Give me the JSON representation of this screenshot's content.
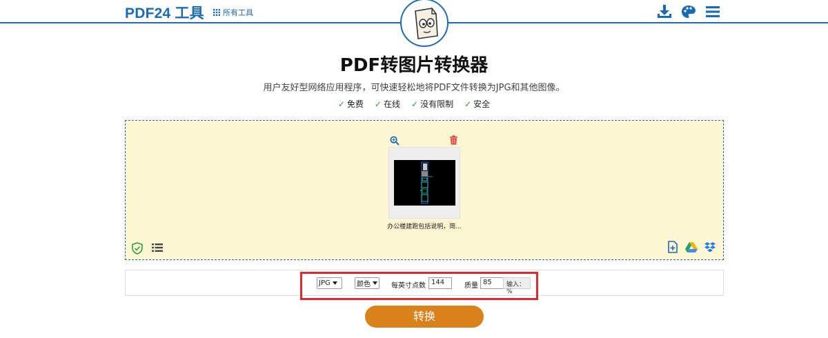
{
  "header": {
    "logo": "PDF24 工具",
    "all_tools": "所有工具",
    "icons": [
      "download-icon",
      "palette-icon",
      "menu-icon"
    ]
  },
  "main": {
    "title": "PDF转图片转换器",
    "subtitle": "用户友好型网络应用程序，可快速轻松地将PDF文件转换为JPG和其他图像。",
    "features": [
      "免费",
      "在线",
      "没有限制",
      "安全"
    ]
  },
  "dropzone": {
    "file_name": "办公楼建跑包括说明，简...",
    "icons": [
      "shield-check-icon",
      "list-icon",
      "add-file-icon",
      "google-drive-icon",
      "dropbox-icon",
      "zoom-in-icon",
      "trash-icon"
    ]
  },
  "options": {
    "format": "JPG",
    "color": "颜色",
    "dpi_label": "每英寸点数",
    "dpi_value": "144",
    "quality_label": "质量",
    "quality_value": "85",
    "quality_hint": "输入：%"
  },
  "convert_label": "转换",
  "colors": {
    "brand_blue": "#1a6bb5",
    "dropzone_bg": "#fdf6d3",
    "convert_orange": "#d9811a",
    "highlight_red": "#e0282f",
    "check_green": "#2e9e3e"
  }
}
